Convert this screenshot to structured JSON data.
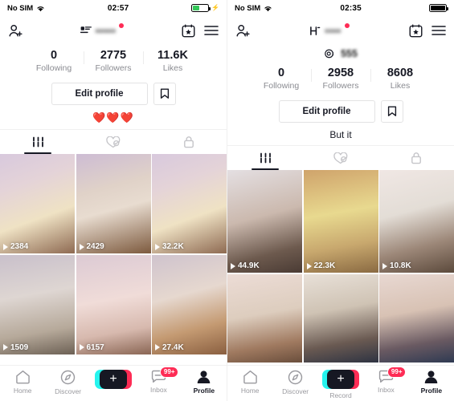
{
  "left": {
    "status_bar": {
      "carrier": "No SIM",
      "wifi_icon": "wifi-icon",
      "time": "02:57",
      "battery_icon": "battery-charging-icon",
      "battery_color": "#34c759",
      "charging": true
    },
    "header": {
      "add_friend_icon": "add-person-icon",
      "verified_icon": "id-badge-icon",
      "username_redacted": "•••••",
      "notification_dot": true,
      "calendar_icon": "calendar-star-icon",
      "menu_icon": "hamburger-menu-icon"
    },
    "handle": {
      "visible": false,
      "at_icon": "",
      "text": ""
    },
    "stats": [
      {
        "value": "0",
        "label": "Following"
      },
      {
        "value": "2775",
        "label": "Followers"
      },
      {
        "value": "11.6K",
        "label": "Likes"
      }
    ],
    "actions": {
      "edit_label": "Edit profile",
      "bookmark_icon": "bookmark-icon"
    },
    "bio": "❤️❤️❤️",
    "tabs": [
      {
        "icon": "grid-posts-icon",
        "active": true
      },
      {
        "icon": "liked-heart-icon",
        "active": false
      },
      {
        "icon": "private-lock-icon",
        "active": false
      }
    ],
    "grid": [
      {
        "views": "2384",
        "c1": "#d8c9dd",
        "c2": "#efe2c4",
        "c3": "#8e6a52"
      },
      {
        "views": "2429",
        "c1": "#cdbcd4",
        "c2": "#e8dcd0",
        "c3": "#7d5a3e"
      },
      {
        "views": "32.2K",
        "c1": "#d8c9dd",
        "c2": "#efe2c4",
        "c3": "#8e6a52"
      },
      {
        "views": "1509",
        "c1": "#c9c0cb",
        "c2": "#ded6d2",
        "c3": "#6d6155"
      },
      {
        "views": "6157",
        "c1": "#dccad4",
        "c2": "#f0dcd8",
        "c3": "#8a6654"
      },
      {
        "views": "27.4K",
        "c1": "#cfc3cd",
        "c2": "#e6d8cf",
        "c3": "#8a5f40"
      }
    ],
    "bottom_nav": [
      {
        "icon": "home-icon",
        "label": "Home",
        "active": false,
        "badge": ""
      },
      {
        "icon": "compass-icon",
        "label": "Discover",
        "active": false,
        "badge": ""
      },
      {
        "icon": "create-plus-icon",
        "label": "",
        "active": false,
        "badge": ""
      },
      {
        "icon": "inbox-message-icon",
        "label": "Inbox",
        "active": false,
        "badge": "99+"
      },
      {
        "icon": "profile-person-icon",
        "label": "Profile",
        "active": true,
        "badge": ""
      }
    ]
  },
  "right": {
    "status_bar": {
      "carrier": "No SIM",
      "wifi_icon": "wifi-icon",
      "time": "02:35",
      "battery_icon": "battery-full-icon",
      "battery_color": "#000000",
      "charging": false
    },
    "header": {
      "add_friend_icon": "add-person-icon",
      "verified_icon": "h-letter-icon",
      "username_redacted": "••••",
      "notification_dot": true,
      "calendar_icon": "calendar-star-icon",
      "menu_icon": "hamburger-menu-icon"
    },
    "handle": {
      "visible": true,
      "at_icon": "at-sign-icon",
      "text": "555"
    },
    "stats": [
      {
        "value": "0",
        "label": "Following"
      },
      {
        "value": "2958",
        "label": "Followers"
      },
      {
        "value": "8608",
        "label": "Likes"
      }
    ],
    "actions": {
      "edit_label": "Edit profile",
      "bookmark_icon": "bookmark-icon"
    },
    "bio": "But it",
    "tabs": [
      {
        "icon": "grid-posts-icon",
        "active": true
      },
      {
        "icon": "liked-heart-icon",
        "active": false
      },
      {
        "icon": "private-lock-icon",
        "active": false
      }
    ],
    "grid": [
      {
        "views": "44.9K",
        "c1": "#e4dfe2",
        "c2": "#cbb9ae",
        "c3": "#4a3b34"
      },
      {
        "views": "22.3K",
        "c1": "#cfa36b",
        "c2": "#e8d98f",
        "c3": "#8a6a42"
      },
      {
        "views": "10.8K",
        "c1": "#f0e7e4",
        "c2": "#e3ddd6",
        "c3": "#5c4a3c"
      },
      {
        "views": "",
        "c1": "#ecdcd6",
        "c2": "#ddcdbe",
        "c3": "#6a4e3c"
      },
      {
        "views": "",
        "c1": "#e8e0d8",
        "c2": "#cfc3b4",
        "c3": "#2e3342"
      },
      {
        "views": "",
        "c1": "#e8d8d2",
        "c2": "#d8c2b4",
        "c3": "#2f3a52"
      }
    ],
    "bottom_nav": [
      {
        "icon": "home-icon",
        "label": "Home",
        "active": false,
        "badge": ""
      },
      {
        "icon": "compass-icon",
        "label": "Discover",
        "active": false,
        "badge": ""
      },
      {
        "icon": "create-plus-icon",
        "label": "Record",
        "active": false,
        "badge": ""
      },
      {
        "icon": "inbox-message-icon",
        "label": "Inbox",
        "active": false,
        "badge": "99+"
      },
      {
        "icon": "profile-person-icon",
        "label": "Profile",
        "active": true,
        "badge": ""
      }
    ]
  },
  "theme": {
    "accent_red": "#fe2c55",
    "accent_cyan": "#25f4ee",
    "text_primary": "#161823",
    "text_muted": "#8a8b91"
  }
}
